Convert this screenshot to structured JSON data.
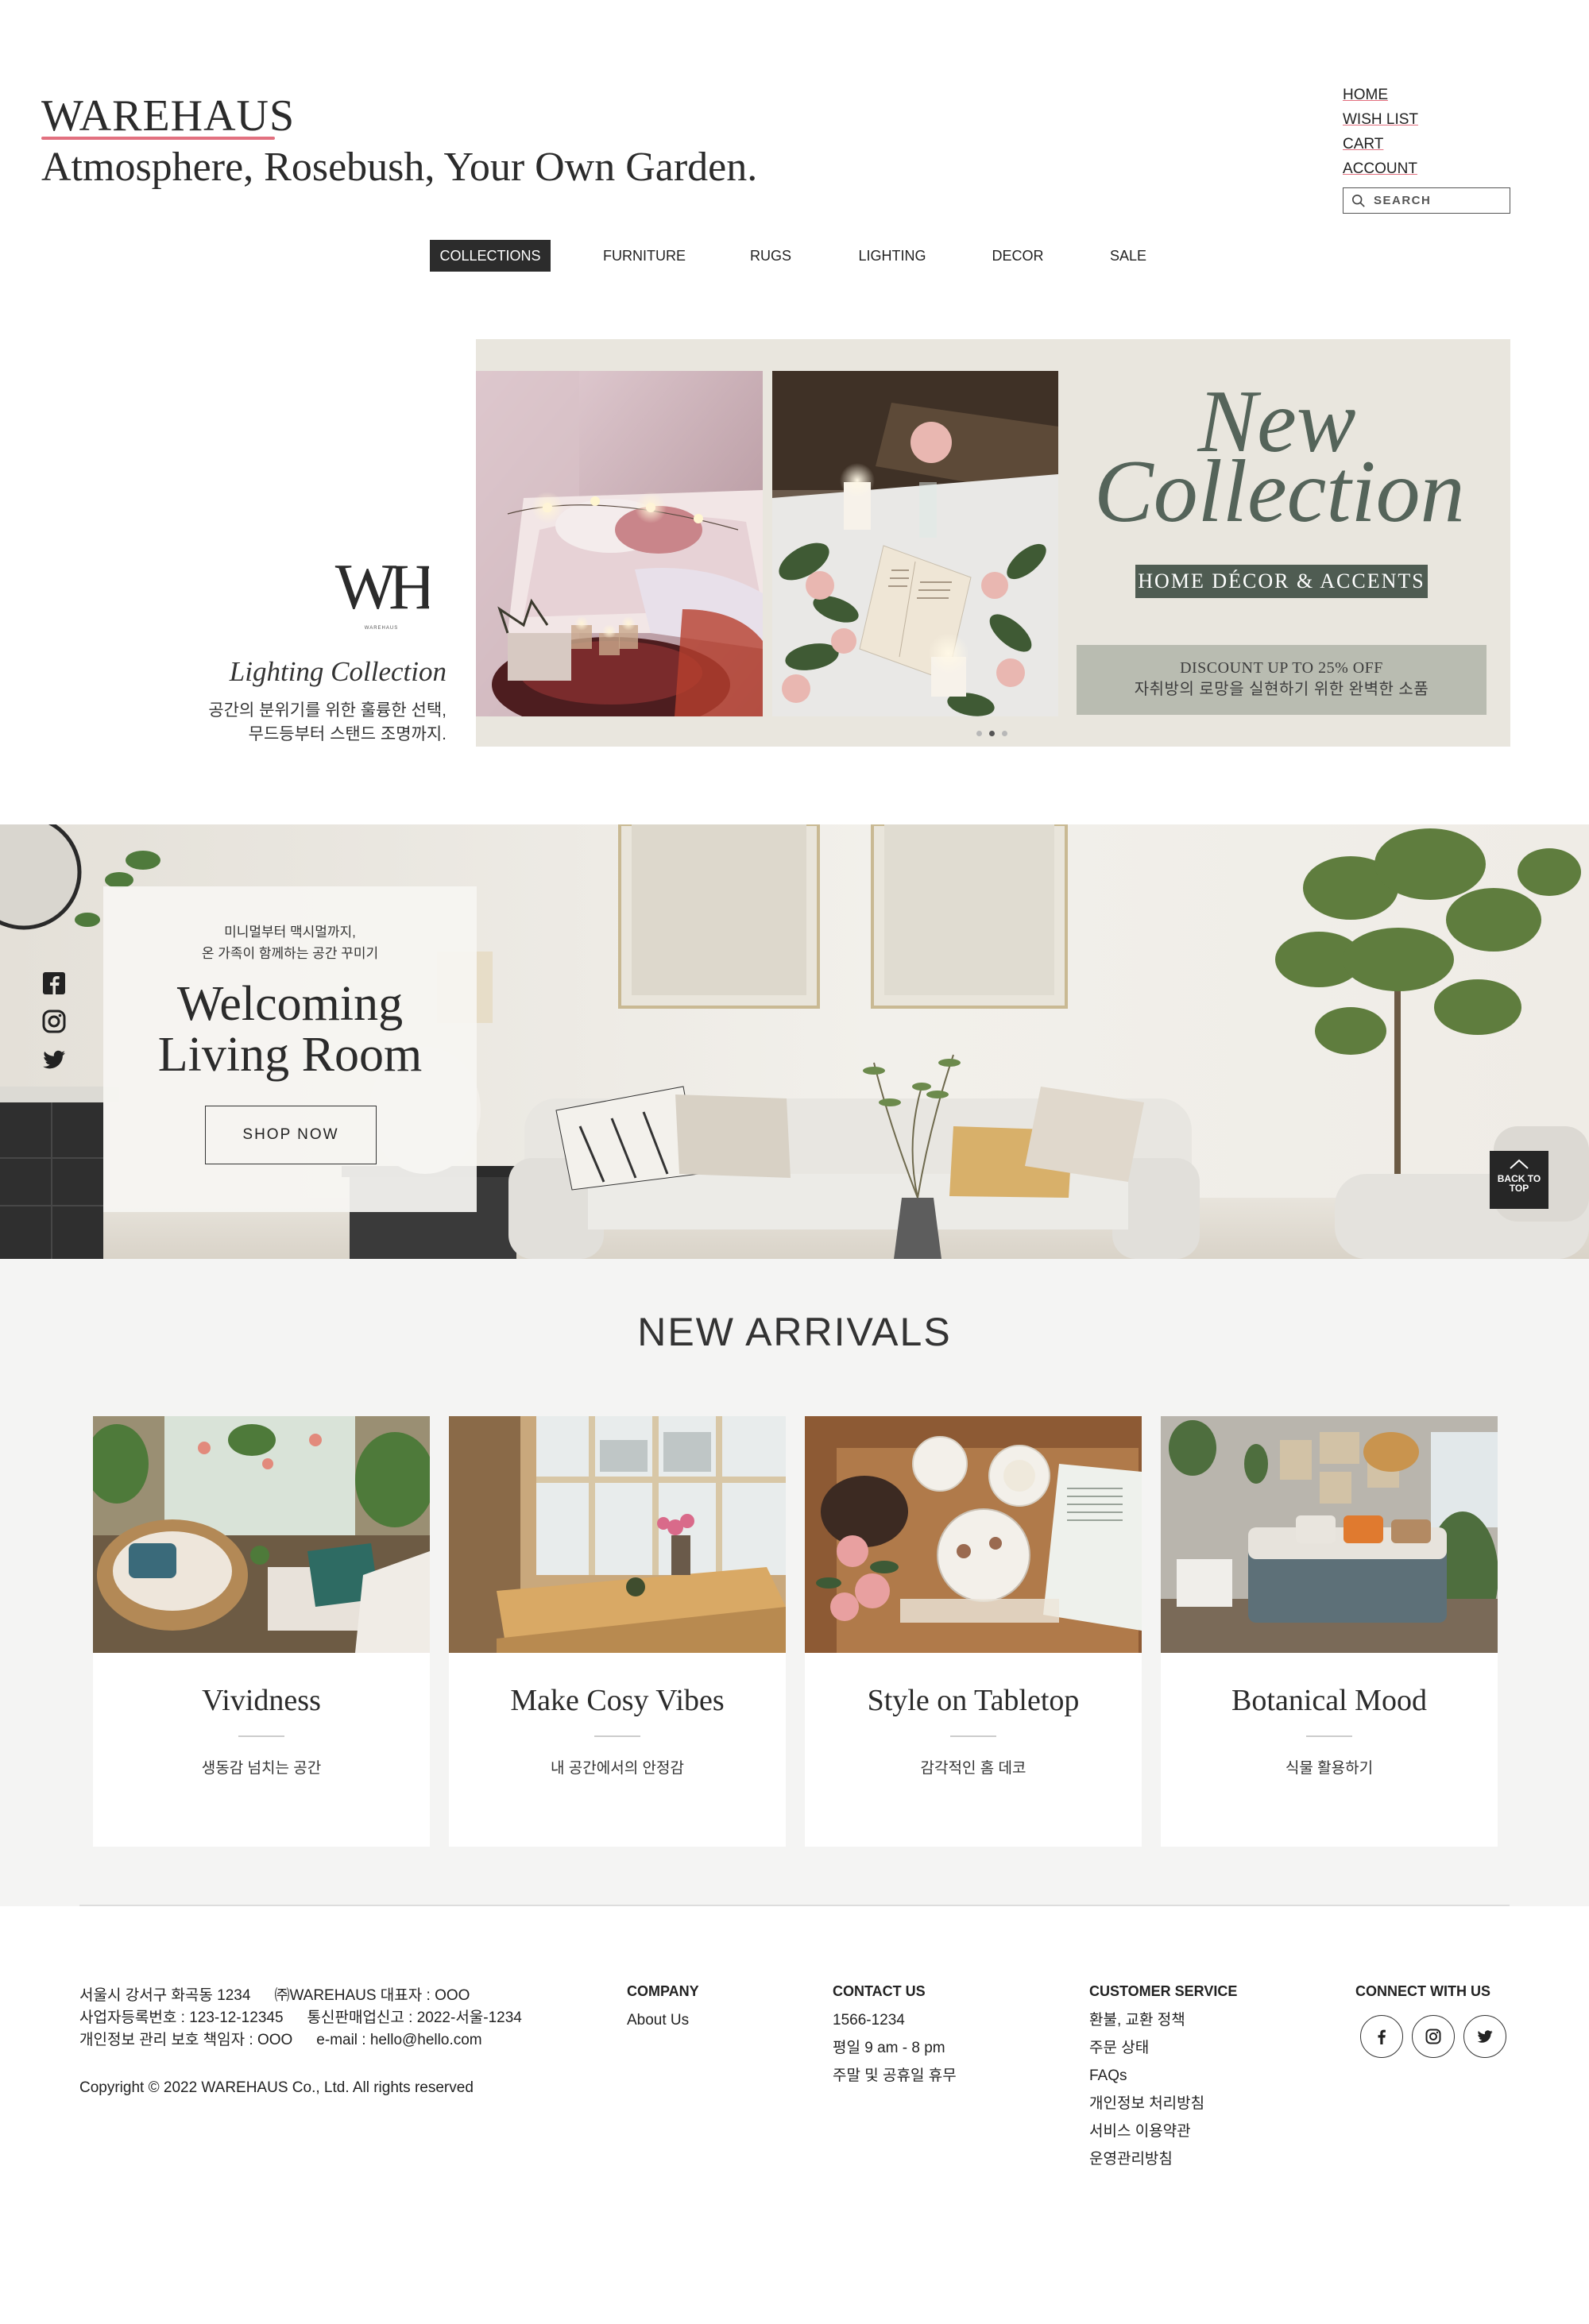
{
  "brand": {
    "logo": "WAREHAUS",
    "tagline": "Atmosphere, Rosebush, Your Own Garden."
  },
  "util_nav": [
    "HOME",
    "WISH LIST",
    "CART",
    "ACCOUNT"
  ],
  "search": {
    "placeholder": "SEARCH"
  },
  "main_nav": {
    "items": [
      "COLLECTIONS",
      "FURNITURE",
      "RUGS",
      "LIGHTING",
      "DECOR",
      "SALE"
    ],
    "active": "COLLECTIONS"
  },
  "hero": {
    "monogram": "WH",
    "monogram_small": "WAREHAUS",
    "collection_title": "Lighting Collection",
    "collection_desc": [
      "공간의 분위기를 위한 훌륭한 선택,",
      "무드등부터 스탠드 조명까지."
    ],
    "slide": {
      "headline": [
        "New",
        "Collection"
      ],
      "badge": "HOME DÉCOR & ACCENTS",
      "discount": [
        "DISCOUNT UP TO 25% OFF",
        "자취방의 로망을 실현하기 위한 완벽한 소품"
      ]
    },
    "slide_count": 3,
    "active_slide": 2
  },
  "living_banner": {
    "subtitle": [
      "미니멀부터 맥시멀까지,",
      "온 가족이 함께하는 공간 꾸미기"
    ],
    "title": [
      "Welcoming",
      "Living Room"
    ],
    "cta": "SHOP NOW",
    "back_to_top": [
      "BACK TO",
      "TOP"
    ],
    "social_icons": [
      "facebook-icon",
      "instagram-icon",
      "twitter-icon"
    ]
  },
  "arrivals": {
    "title": "NEW ARRIVALS",
    "cards": [
      {
        "title": "Vividness",
        "subtitle": "생동감 넘치는 공간"
      },
      {
        "title": "Make Cosy Vibes",
        "subtitle": "내 공간에서의 안정감"
      },
      {
        "title": "Style on Tabletop",
        "subtitle": "감각적인 홈 데코"
      },
      {
        "title": "Botanical Mood",
        "subtitle": "식물 활용하기"
      }
    ]
  },
  "footer": {
    "info": [
      [
        "서울시 강서구 화곡동 1234",
        "㈜WAREHAUS 대표자 : OOO"
      ],
      [
        "사업자등록번호 : 123-12-12345",
        "통신판매업신고 : 2022-서울-1234"
      ],
      [
        "개인정보 관리 보호 책임자 : OOO",
        "e-mail : hello@hello.com"
      ]
    ],
    "copyright": "Copyright © 2022 WAREHAUS Co., Ltd. All rights reserved",
    "company": {
      "heading": "COMPANY",
      "links": [
        "About Us"
      ]
    },
    "contact": {
      "heading": "CONTACT US",
      "lines": [
        "1566-1234",
        "평일 9 am - 8 pm",
        "주말 및 공휴일 휴무"
      ]
    },
    "customer_service": {
      "heading": "CUSTOMER SERVICE",
      "links": [
        "환불, 교환 정책",
        "주문 상태",
        "FAQs",
        "개인정보 처리방침",
        "서비스 이용약관",
        "운영관리방침"
      ]
    },
    "connect": {
      "heading": "CONNECT WITH US",
      "icons": [
        "facebook-icon",
        "instagram-icon",
        "twitter-icon"
      ]
    }
  },
  "colors": {
    "accent_pink": "#e2707f",
    "dark": "#2c2c2c",
    "sage": "#55645a",
    "panel_bg": "#f4f4f3"
  }
}
